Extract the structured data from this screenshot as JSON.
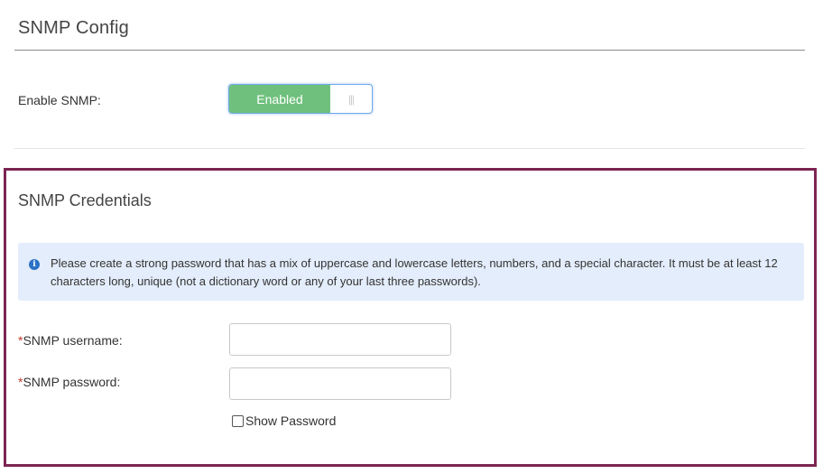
{
  "snmp_config": {
    "title": "SNMP Config",
    "enable_label": "Enable SNMP:",
    "toggle_state": "Enabled",
    "toggle_handle_glyph": "|||",
    "toggle_color": "#6fc07d"
  },
  "snmp_credentials": {
    "title": "SNMP Credentials",
    "highlight_border_color": "#7b2553",
    "info_icon": "info-circle-icon",
    "info_icon_glyph": "i",
    "info_text": "Please create a strong password that has a mix of uppercase and lowercase letters, numbers, and a special character. It must be at least 12 characters long, unique (not a dictionary word or any of your last three passwords).",
    "required_marker": "*",
    "username_label": "SNMP username:",
    "username_value": "",
    "password_label": "SNMP password:",
    "password_value": "",
    "show_password_label": "Show Password",
    "show_password_checked": false
  }
}
